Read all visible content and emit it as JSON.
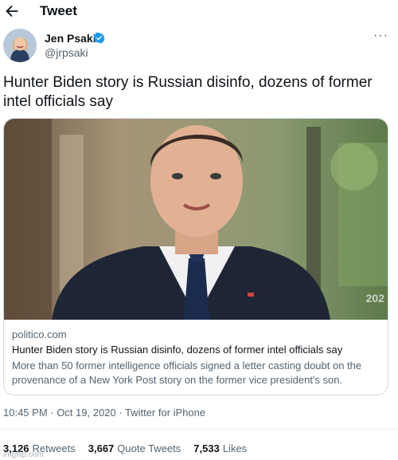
{
  "header": {
    "title": "Tweet"
  },
  "author": {
    "name": "Jen Psaki",
    "handle": "@jrpsaki"
  },
  "tweet": {
    "text": "Hunter Biden story is Russian disinfo, dozens of former intel officials say"
  },
  "card": {
    "domain": "politico.com",
    "title": "Hunter Biden story is Russian disinfo, dozens of former intel officials say",
    "description": "More than 50 former intelligence officials signed a letter casting doubt on the provenance of a New York Post story on the former vice president's son.",
    "image_overlay_text": "202"
  },
  "meta": {
    "timestamp": "10:45 PM · Oct 19, 2020 · Twitter for iPhone"
  },
  "stats": [
    {
      "value": "3,126",
      "label": "Retweets"
    },
    {
      "value": "3,667",
      "label": "Quote Tweets"
    },
    {
      "value": "7,533",
      "label": "Likes"
    }
  ],
  "watermark": "imgflip.com",
  "colors": {
    "verified_badge": "#1d9bf0",
    "text_primary": "#0f1419",
    "text_secondary": "#536471",
    "border": "#cfd9de"
  },
  "icons": [
    "back-arrow-icon",
    "verified-badge-icon",
    "more-options-icon"
  ]
}
